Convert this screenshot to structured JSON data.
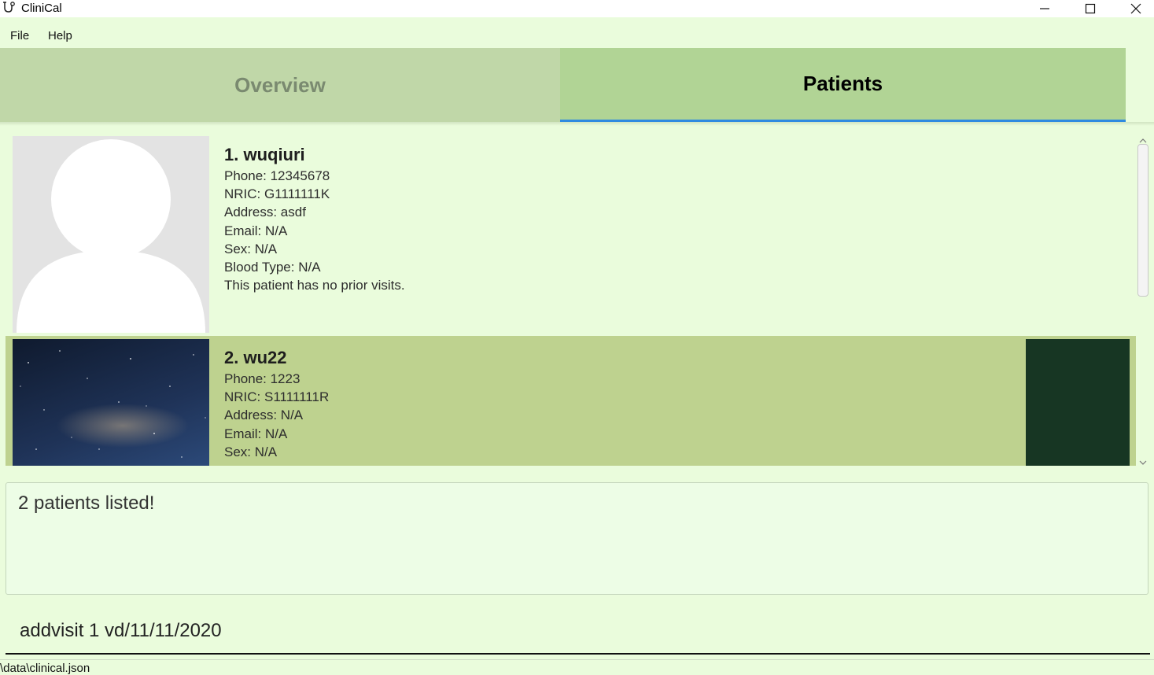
{
  "window": {
    "title": "CliniCal",
    "icon": "stethoscope-icon"
  },
  "menu": {
    "file": "File",
    "help": "Help"
  },
  "tabs": [
    {
      "label": "Overview",
      "selected": false
    },
    {
      "label": "Patients",
      "selected": true
    }
  ],
  "patients": [
    {
      "name": "1.  wuqiuri",
      "photo": "default-avatar",
      "fields": {
        "phone": "Phone: 12345678",
        "nric": "NRIC: G1111111K",
        "address": "Address: asdf",
        "email": "Email: N/A",
        "sex": "Sex: N/A",
        "blood_type": "Blood Type: N/A",
        "visits": "This patient has no prior visits."
      }
    },
    {
      "name": "2.  wu22",
      "photo": "galaxy-photo",
      "fields": {
        "phone": "Phone: 1223",
        "nric": "NRIC: S1111111R",
        "address": "Address: N/A",
        "email": "Email: N/A",
        "sex": "Sex: N/A"
      }
    }
  ],
  "result": {
    "message": "2 patients listed!"
  },
  "command": {
    "value": "addvisit 1 vd/11/11/2020"
  },
  "status": {
    "file_path": "\\data\\clinical.json"
  },
  "colors": {
    "background": "#eafcdc",
    "tab_selected": "#b1d495",
    "tab_unselected": "#c0d7a8",
    "selected_card": "#bed28f",
    "tab_underline": "#2f8ae0",
    "dark_box": "#173623"
  }
}
